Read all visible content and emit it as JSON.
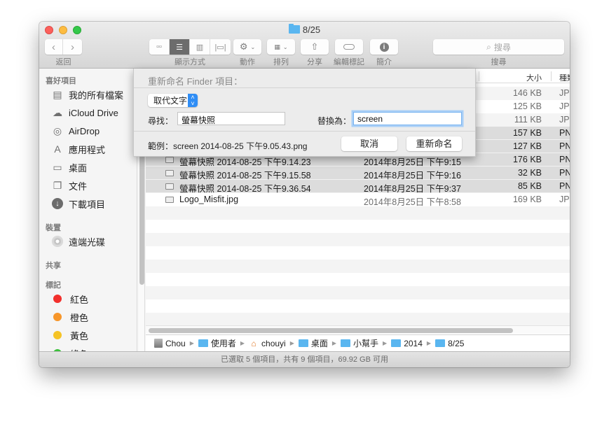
{
  "window": {
    "title": "8/25",
    "title_icon": "folder-icon"
  },
  "toolbar": {
    "back_label": "返回",
    "view_label": "顯示方式",
    "action_label": "動作",
    "arrange_label": "排列",
    "share_label": "分享",
    "tags_label": "編輯標記",
    "info_label": "簡介",
    "search_label": "搜尋",
    "search_placeholder": "搜尋",
    "active_view": "list"
  },
  "sidebar": {
    "favorites_heading": "喜好項目",
    "favorites": [
      {
        "label": "我的所有檔案",
        "icon": "all-files-icon"
      },
      {
        "label": "iCloud Drive",
        "icon": "cloud-icon"
      },
      {
        "label": "AirDrop",
        "icon": "airdrop-icon"
      },
      {
        "label": "應用程式",
        "icon": "applications-icon"
      },
      {
        "label": "桌面",
        "icon": "desktop-icon"
      },
      {
        "label": "文件",
        "icon": "documents-icon"
      },
      {
        "label": "下載項目",
        "icon": "downloads-icon"
      }
    ],
    "devices_heading": "裝置",
    "devices": [
      {
        "label": "遠端光碟",
        "icon": "disc-icon"
      }
    ],
    "shared_heading": "共享",
    "tags_heading": "標記",
    "tags": [
      {
        "label": "紅色",
        "color": "#f2302c"
      },
      {
        "label": "橙色",
        "color": "#f7962a"
      },
      {
        "label": "黃色",
        "color": "#f5c325"
      },
      {
        "label": "綠色",
        "color": "#3cc13c"
      }
    ]
  },
  "list": {
    "columns": {
      "size": "大小",
      "kind": "種類"
    },
    "rows": [
      {
        "name": "",
        "date": "",
        "size": "146 KB",
        "kind": "JP",
        "selected": false
      },
      {
        "name": "",
        "date": "",
        "size": "125 KB",
        "kind": "JP",
        "selected": false
      },
      {
        "name": "",
        "date": "",
        "size": "111 KB",
        "kind": "JP",
        "selected": false
      },
      {
        "name": "",
        "date": "",
        "size": "157 KB",
        "kind": "PN",
        "selected": true
      },
      {
        "name": "",
        "date": "",
        "size": "127 KB",
        "kind": "PN",
        "selected": true
      },
      {
        "name": "螢幕快照 2014-08-25 下午9.14.23",
        "date": "2014年8月25日 下午9:15",
        "size": "176 KB",
        "kind": "PN",
        "selected": true
      },
      {
        "name": "螢幕快照 2014-08-25 下午9.15.58",
        "date": "2014年8月25日 下午9:16",
        "size": "32 KB",
        "kind": "PN",
        "selected": true
      },
      {
        "name": "螢幕快照 2014-08-25 下午9.36.54",
        "date": "2014年8月25日 下午9:37",
        "size": "85 KB",
        "kind": "PN",
        "selected": true
      },
      {
        "name": "Logo_Misfit.jpg",
        "date": "2014年8月25日 下午8:58",
        "size": "169 KB",
        "kind": "JP",
        "selected": false
      }
    ]
  },
  "pathbar": [
    {
      "label": "Chou",
      "icon": "disk-icon"
    },
    {
      "label": "使用者",
      "icon": "users-folder-icon"
    },
    {
      "label": "chouyi",
      "icon": "home-icon"
    },
    {
      "label": "桌面",
      "icon": "desktop-folder-icon"
    },
    {
      "label": "小幫手",
      "icon": "folder-icon"
    },
    {
      "label": "2014",
      "icon": "folder-icon"
    },
    {
      "label": "8/25",
      "icon": "folder-icon"
    }
  ],
  "status": "已選取 5 個項目，共有 9 個項目，69.92 GB 可用",
  "rename_dialog": {
    "title": "重新命名 Finder 項目：",
    "mode": "取代文字",
    "find_label": "尋找：",
    "find_value": "螢幕快照",
    "replace_label": "替換為：",
    "replace_value": "screen",
    "example": "範例：screen 2014-08-25 下午9.05.43.png",
    "cancel_label": "取消",
    "rename_label": "重新命名"
  }
}
